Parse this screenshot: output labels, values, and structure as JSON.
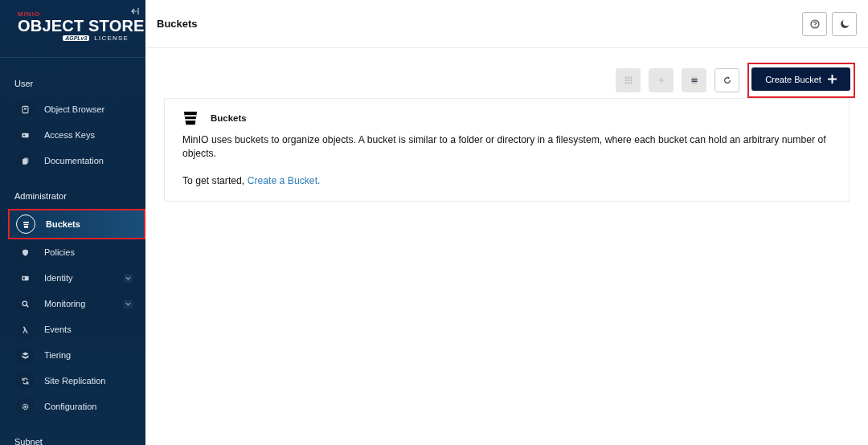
{
  "logo": {
    "brand": "MINIO",
    "product": "OBJECT STORE",
    "badge": "AGPLv3",
    "license": "LICENSE"
  },
  "sidebar": {
    "sections": [
      {
        "title": "User",
        "items": [
          {
            "label": "Object Browser",
            "kind": "browser",
            "selected": false,
            "highlighted": false
          },
          {
            "label": "Access Keys",
            "kind": "keys",
            "selected": false,
            "highlighted": false
          },
          {
            "label": "Documentation",
            "kind": "docs",
            "selected": false,
            "highlighted": false
          }
        ]
      },
      {
        "title": "Administrator",
        "items": [
          {
            "label": "Buckets",
            "kind": "bucket",
            "selected": true,
            "highlighted": true
          },
          {
            "label": "Policies",
            "kind": "policy",
            "selected": false,
            "highlighted": false
          },
          {
            "label": "Identity",
            "kind": "identity",
            "selected": false,
            "highlighted": false,
            "expandable": true
          },
          {
            "label": "Monitoring",
            "kind": "monitor",
            "selected": false,
            "highlighted": false,
            "expandable": true
          },
          {
            "label": "Events",
            "kind": "lambda",
            "selected": false,
            "highlighted": false
          },
          {
            "label": "Tiering",
            "kind": "tier",
            "selected": false,
            "highlighted": false
          },
          {
            "label": "Site Replication",
            "kind": "replicate",
            "selected": false,
            "highlighted": false
          },
          {
            "label": "Configuration",
            "kind": "gear",
            "selected": false,
            "highlighted": false
          }
        ]
      },
      {
        "title": "Subnet"
      }
    ]
  },
  "header": {
    "title": "Buckets"
  },
  "toolbar": [
    {
      "kind": "grid",
      "disabled": true
    },
    {
      "kind": "bolt",
      "disabled": true
    },
    {
      "kind": "bucket",
      "disabled": true
    },
    {
      "kind": "refresh",
      "disabled": false
    }
  ],
  "create_button": {
    "label": "Create Bucket",
    "highlighted": true
  },
  "card": {
    "title": "Buckets",
    "text": "MinIO uses buckets to organize objects. A bucket is similar to a folder or directory in a filesystem, where each bucket can hold an arbitrary number of objects.",
    "prompt": "To get started,",
    "link": "Create a Bucket."
  }
}
